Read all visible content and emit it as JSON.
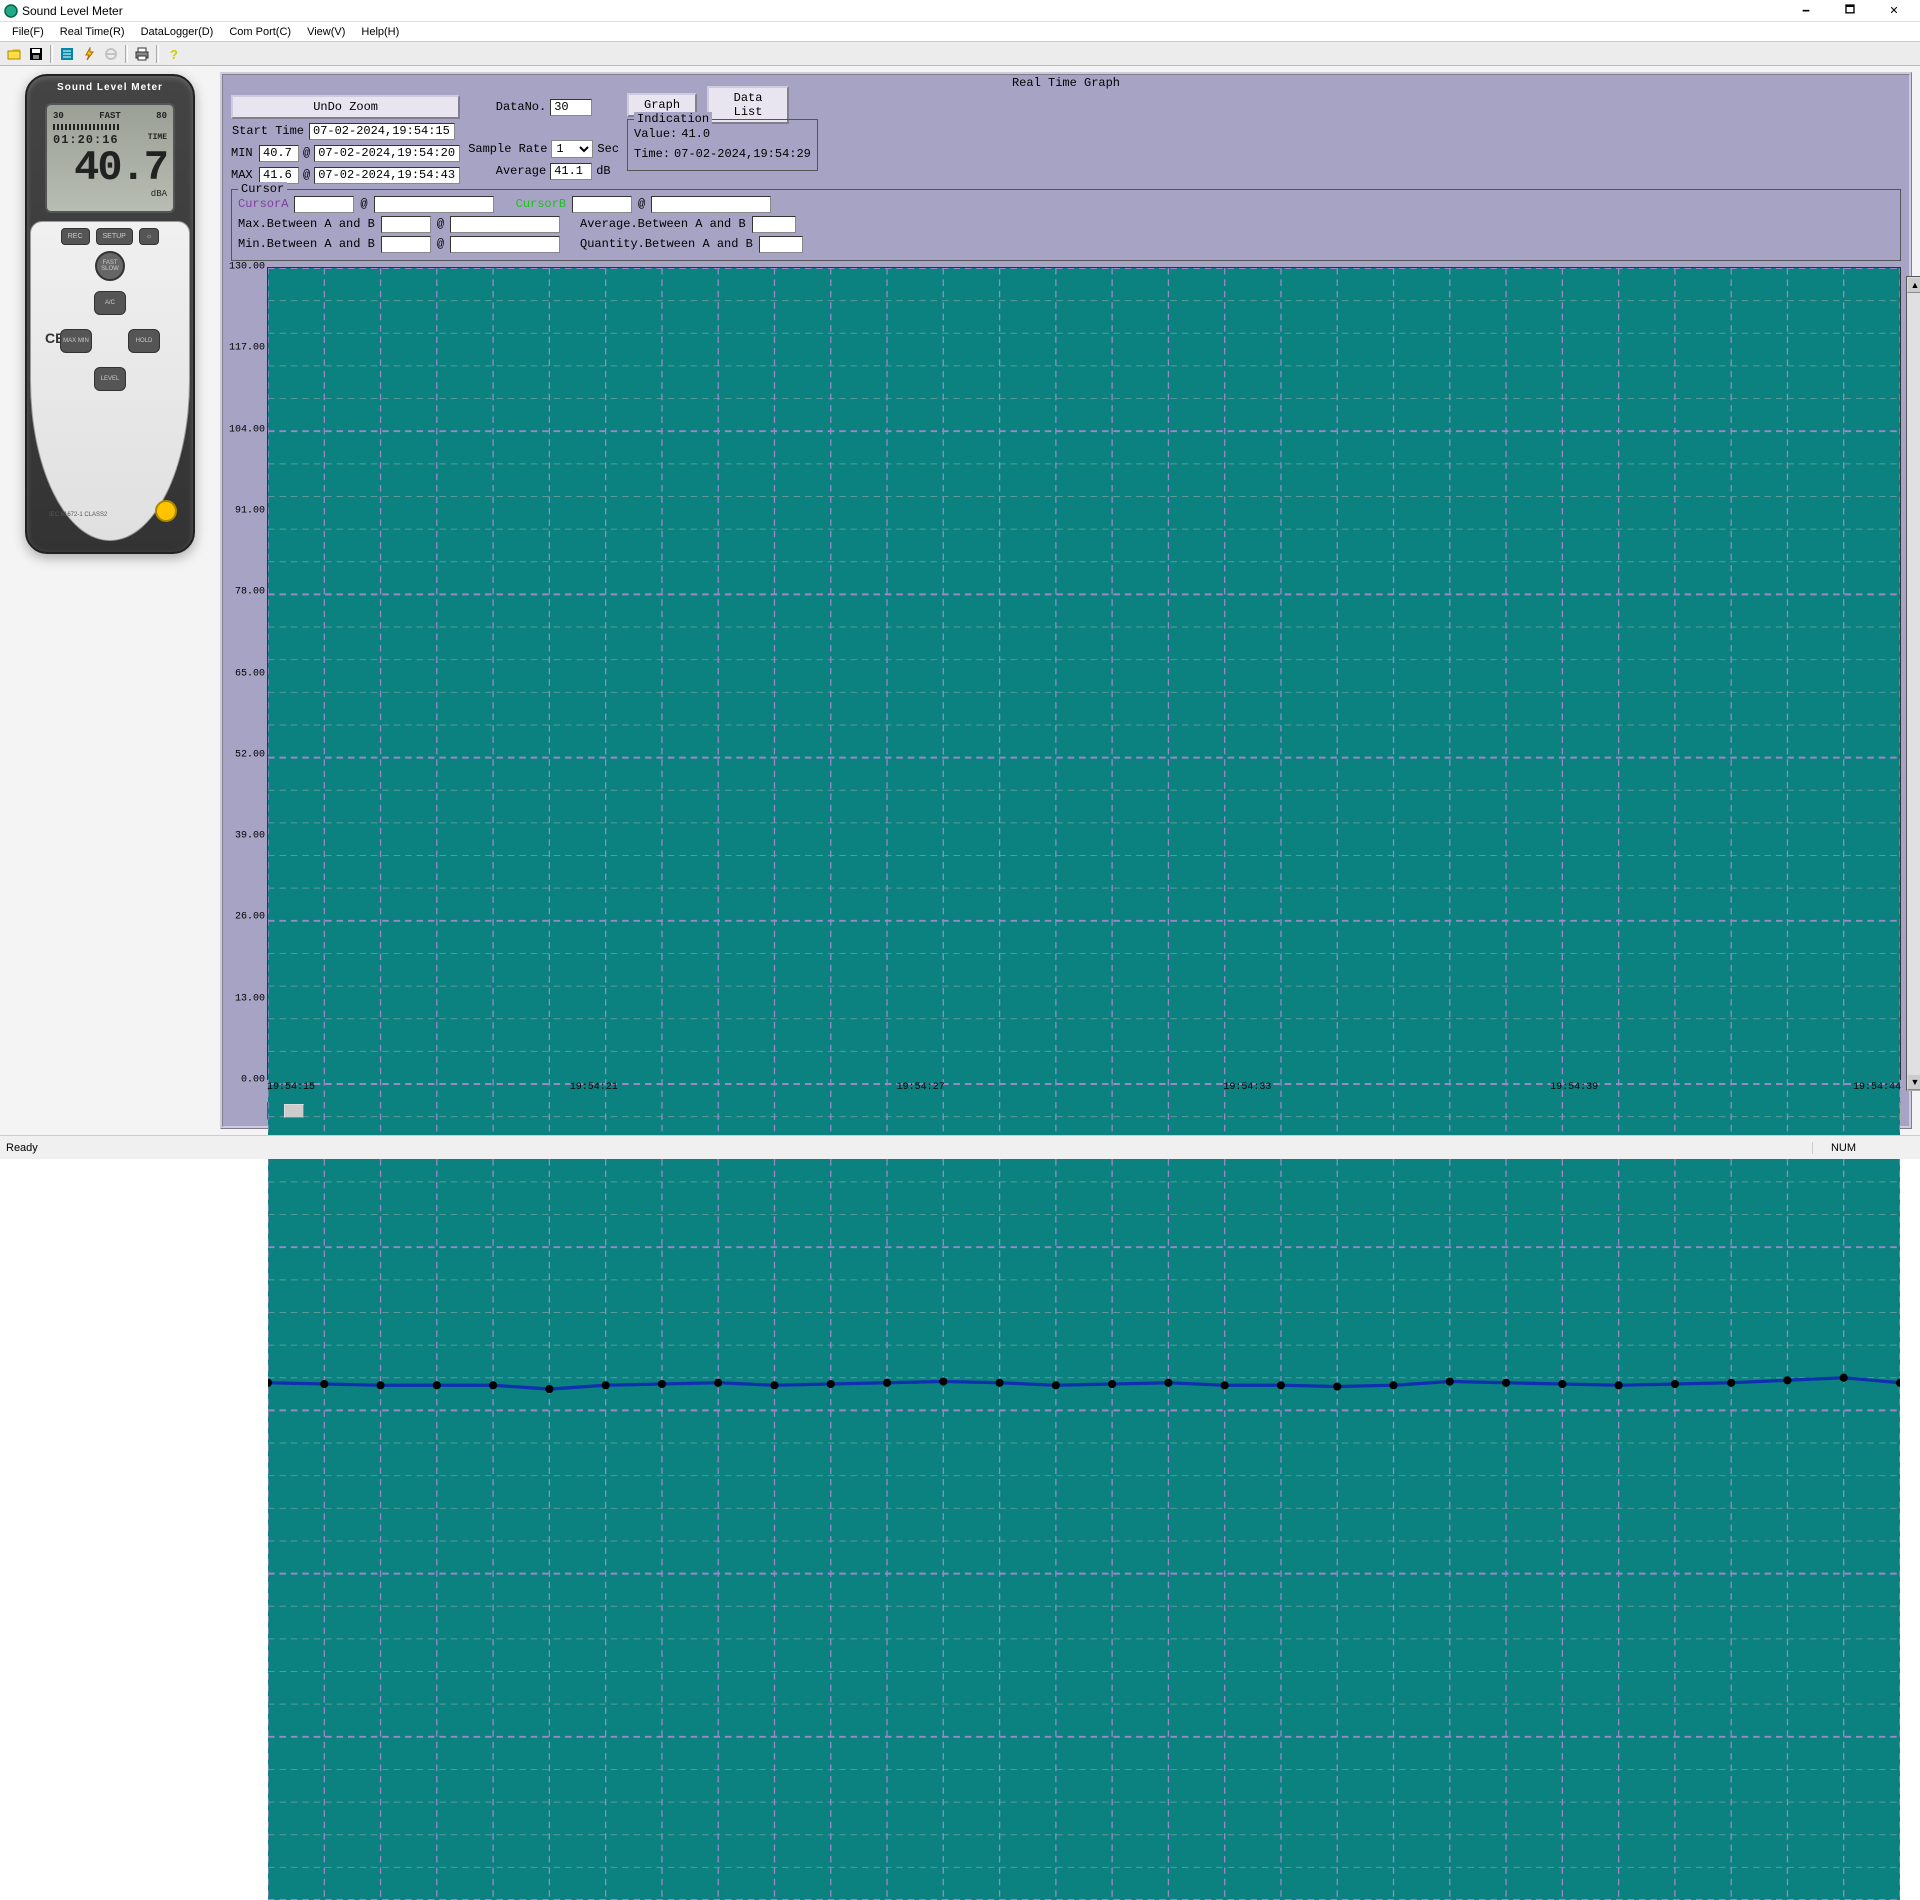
{
  "window": {
    "title": "Sound Level Meter"
  },
  "menu": {
    "file": "File(F)",
    "realtime": "Real Time(R)",
    "datalogger": "DataLogger(D)",
    "comport": "Com Port(C)",
    "view": "View(V)",
    "help": "Help(H)"
  },
  "device": {
    "header": "Sound Level Meter",
    "scale_low": "30",
    "scale_high": "80",
    "speed": "FAST",
    "clock": "01:20:16",
    "clock_label": "TIME",
    "reading": "40.7",
    "unit": "dBA",
    "buttons": {
      "rec": "REC",
      "setup": "SETUP",
      "light": "☼",
      "fastslow": "FAST\nSLOW",
      "ac": "A/C",
      "maxmin": "MAX\nMIN",
      "hold": "HOLD",
      "level": "LEVEL"
    },
    "ce": "CE",
    "iec": "IEC 61672-1 CLASS2"
  },
  "panel": {
    "title": "Real Time Graph",
    "undo": "UnDo Zoom",
    "graph_btn": "Graph",
    "datalist_btn": "Data List",
    "datano_label": "DataNo.",
    "datano": "30",
    "starttime_label": "Start Time",
    "starttime": "07-02-2024,19:54:15",
    "min_label": "MIN",
    "min": "40.7",
    "min_at": "07-02-2024,19:54:20",
    "max_label": "MAX",
    "max": "41.6",
    "max_at": "07-02-2024,19:54:43",
    "at": "@",
    "samplerate_label": "Sample Rate",
    "samplerate": "1",
    "sec": "Sec",
    "average_label": "Average",
    "average": "41.1",
    "db": "dB",
    "indication_legend": "Indication",
    "value_label": "Value:",
    "value": "41.0",
    "time_label": "Time:",
    "time": "07-02-2024,19:54:29",
    "cursor_legend": "Cursor",
    "cursorA": "CursorA",
    "cursorB": "CursorB",
    "cA1": "",
    "cA2": "",
    "cB1": "",
    "cB2": "",
    "maxAB_label": "Max.Between A and B",
    "maxAB1": "",
    "maxAB2": "",
    "avgAB_label": "Average.Between A and B",
    "avgAB": "",
    "minAB_label": "Min.Between A and B",
    "minAB1": "",
    "minAB2": "",
    "qtyAB_label": "Quantity.Between A and B",
    "qtyAB": ""
  },
  "chart_data": {
    "type": "line",
    "title": "Real Time Graph",
    "xlabel": "",
    "ylabel": "",
    "ylim": [
      0,
      130
    ],
    "y_ticks": [
      "130.00",
      "117.00",
      "104.00",
      "91.00",
      "78.00",
      "65.00",
      "52.00",
      "39.00",
      "26.00",
      "13.00",
      "0.00"
    ],
    "x_ticks": [
      "19:54:15",
      "19:54:21",
      "19:54:27",
      "19:54:33",
      "19:54:39",
      "19:54:44"
    ],
    "x": [
      15,
      16,
      17,
      18,
      19,
      20,
      21,
      22,
      23,
      24,
      25,
      26,
      27,
      28,
      29,
      30,
      31,
      32,
      33,
      34,
      35,
      36,
      37,
      38,
      39,
      40,
      41,
      42,
      43,
      44
    ],
    "values": [
      41.2,
      41.1,
      41.0,
      41.0,
      41.0,
      40.7,
      41.0,
      41.1,
      41.2,
      41.0,
      41.1,
      41.2,
      41.3,
      41.2,
      41.0,
      41.1,
      41.2,
      41.0,
      41.0,
      40.9,
      41.0,
      41.3,
      41.2,
      41.1,
      41.0,
      41.1,
      41.2,
      41.4,
      41.6,
      41.2
    ],
    "grid_x": 29,
    "grid_y_major": 10,
    "grid_y_minor": 5,
    "colors": {
      "bg": "#0b8280",
      "grid_major": "#9a88c8",
      "grid_minor": "#5c9a97",
      "line": "#1030b0"
    }
  },
  "status": {
    "ready": "Ready",
    "num": "NUM"
  }
}
